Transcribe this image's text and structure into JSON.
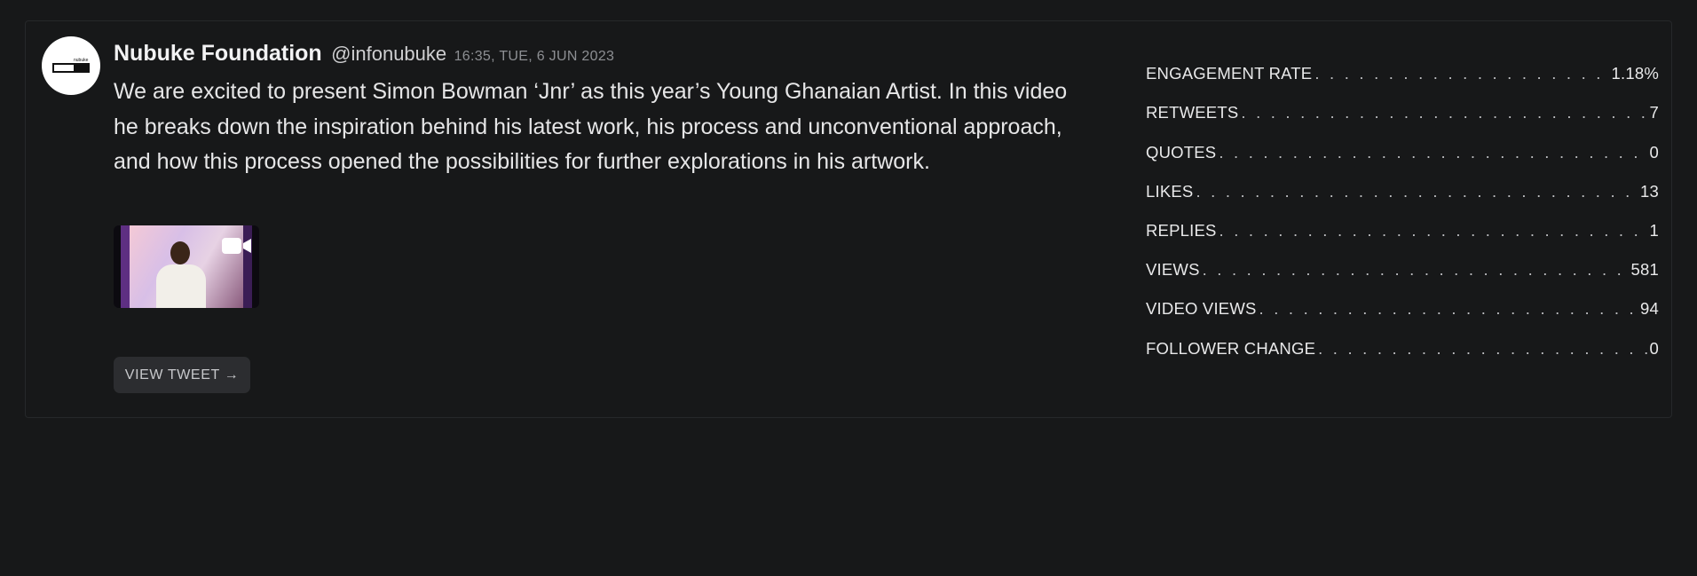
{
  "tweet": {
    "author_name": "Nubuke Foundation",
    "handle": "@infonubuke",
    "timestamp": "16:35, TUE, 6 JUN 2023",
    "text": "We are excited to present Simon Bowman ‘Jnr’ as this year’s Young Ghanaian Artist. In this video he breaks down the inspiration behind his latest work, his process and unconventional approach, and how this process opened the possibilities for further explorations in his artwork.",
    "avatar_logo_text": "nubuke",
    "media_type_icon": "video-camera-icon",
    "view_button_label": "VIEW TWEET →"
  },
  "stats": [
    {
      "label": "ENGAGEMENT RATE",
      "value": "1.18%"
    },
    {
      "label": "RETWEETS",
      "value": "7"
    },
    {
      "label": "QUOTES",
      "value": "0"
    },
    {
      "label": "LIKES",
      "value": "13"
    },
    {
      "label": "REPLIES",
      "value": "1"
    },
    {
      "label": "VIEWS",
      "value": "581"
    },
    {
      "label": "VIDEO VIEWS",
      "value": "94"
    },
    {
      "label": "FOLLOWER CHANGE",
      "value": "0"
    }
  ],
  "colors": {
    "background": "#171819",
    "card_border": "#26282a",
    "button_bg": "#2c2d30"
  }
}
